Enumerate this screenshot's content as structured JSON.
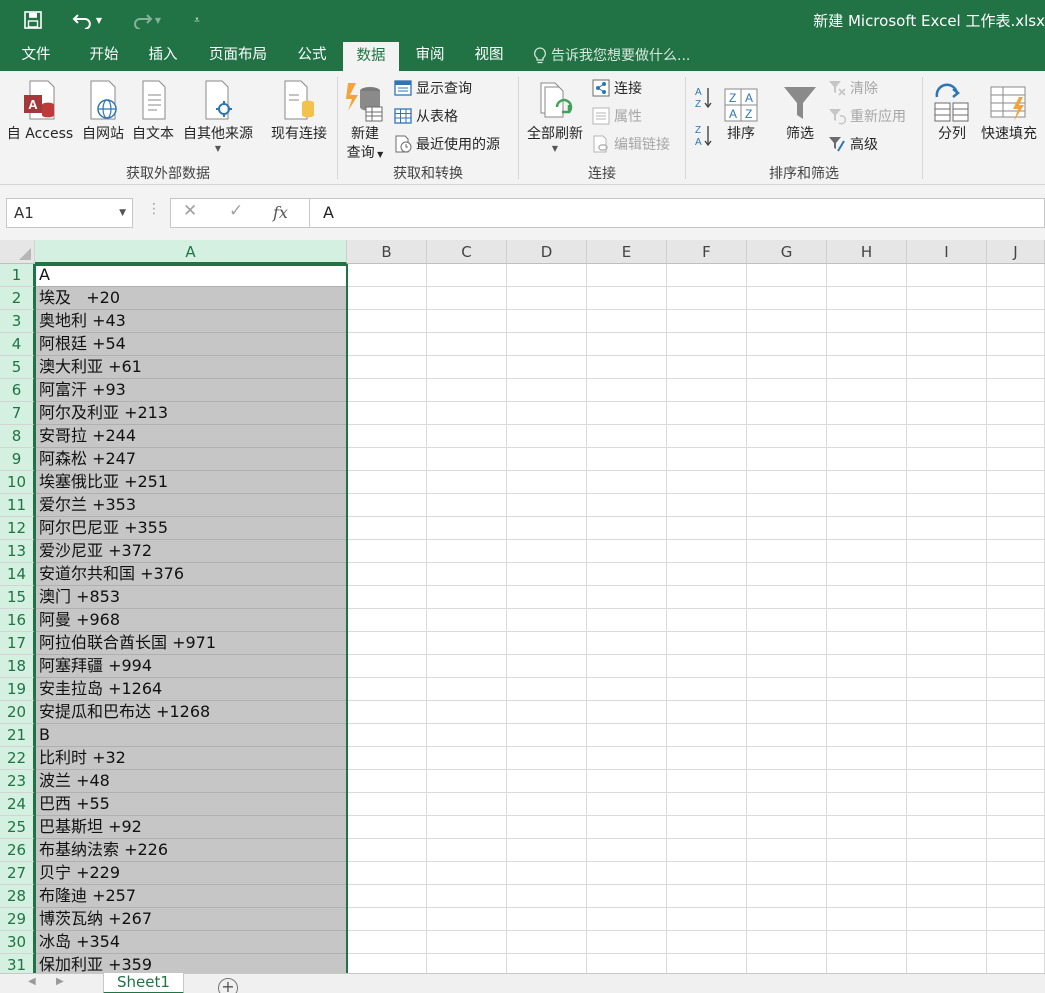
{
  "window": {
    "title": "新建 Microsoft Excel 工作表.xlsx",
    "qat": {
      "save_icon": "save-icon",
      "undo_icon": "undo-icon",
      "redo_icon": "redo-icon",
      "customize_icon": "customize-qat-icon"
    }
  },
  "tabs": [
    {
      "label": "文件"
    },
    {
      "label": "开始"
    },
    {
      "label": "插入"
    },
    {
      "label": "页面布局"
    },
    {
      "label": "公式"
    },
    {
      "label": "数据"
    },
    {
      "label": "审阅"
    },
    {
      "label": "视图"
    }
  ],
  "active_tab": "数据",
  "tell_me": "告诉我您想要做什么...",
  "ribbon": {
    "get_external": {
      "label": "获取外部数据",
      "from_access": "自 Access",
      "from_web": "自网站",
      "from_text": "自文本",
      "from_other": "自其他来源",
      "existing_connections": "现有连接"
    },
    "get_transform": {
      "label": "获取和转换",
      "new_query_line1": "新建",
      "new_query_line2": "查询",
      "show_queries": "显示查询",
      "from_table": "从表格",
      "recent_sources": "最近使用的源"
    },
    "connections": {
      "label": "连接",
      "refresh_all": "全部刷新",
      "connections": "连接",
      "properties": "属性",
      "edit_links": "编辑链接"
    },
    "sort_filter": {
      "label": "排序和筛选",
      "sort": "排序",
      "filter": "筛选",
      "clear": "清除",
      "reapply": "重新应用",
      "advanced": "高级"
    },
    "data_tools": {
      "text_to_columns": "分列",
      "flash_fill": "快速填充"
    }
  },
  "formula_bar": {
    "name_box": "A1",
    "cancel_symbol": "✕",
    "enter_symbol": "✓",
    "fx_symbol": "fx",
    "formula": "A"
  },
  "columns": [
    "A",
    "B",
    "C",
    "D",
    "E",
    "F",
    "G",
    "H",
    "I",
    "J"
  ],
  "rows": [
    {
      "n": "1",
      "a": "A"
    },
    {
      "n": "2",
      "a": "埃及   +20"
    },
    {
      "n": "3",
      "a": "奥地利 +43"
    },
    {
      "n": "4",
      "a": "阿根廷 +54"
    },
    {
      "n": "5",
      "a": "澳大利亚 +61"
    },
    {
      "n": "6",
      "a": "阿富汗 +93"
    },
    {
      "n": "7",
      "a": "阿尔及利亚 +213"
    },
    {
      "n": "8",
      "a": "安哥拉 +244"
    },
    {
      "n": "9",
      "a": "阿森松 +247"
    },
    {
      "n": "10",
      "a": "埃塞俄比亚 +251"
    },
    {
      "n": "11",
      "a": "爱尔兰 +353"
    },
    {
      "n": "12",
      "a": "阿尔巴尼亚 +355"
    },
    {
      "n": "13",
      "a": "爱沙尼亚 +372"
    },
    {
      "n": "14",
      "a": "安道尔共和国 +376"
    },
    {
      "n": "15",
      "a": "澳门 +853"
    },
    {
      "n": "16",
      "a": "阿曼 +968"
    },
    {
      "n": "17",
      "a": "阿拉伯联合酋长国 +971"
    },
    {
      "n": "18",
      "a": "阿塞拜疆 +994"
    },
    {
      "n": "19",
      "a": "安圭拉岛 +1264"
    },
    {
      "n": "20",
      "a": "安提瓜和巴布达 +1268"
    },
    {
      "n": "21",
      "a": "B"
    },
    {
      "n": "22",
      "a": "比利时 +32"
    },
    {
      "n": "23",
      "a": "波兰 +48"
    },
    {
      "n": "24",
      "a": "巴西 +55"
    },
    {
      "n": "25",
      "a": "巴基斯坦 +92"
    },
    {
      "n": "26",
      "a": "布基纳法索 +226"
    },
    {
      "n": "27",
      "a": "贝宁 +229"
    },
    {
      "n": "28",
      "a": "布隆迪 +257"
    },
    {
      "n": "29",
      "a": "博茨瓦纳 +267"
    },
    {
      "n": "30",
      "a": "冰岛 +354"
    },
    {
      "n": "31",
      "a": "保加利亚 +359"
    }
  ],
  "sheets": [
    {
      "label": "Sheet1"
    }
  ],
  "colors": {
    "accent": "#217346",
    "selection": "#c6c6c6"
  }
}
